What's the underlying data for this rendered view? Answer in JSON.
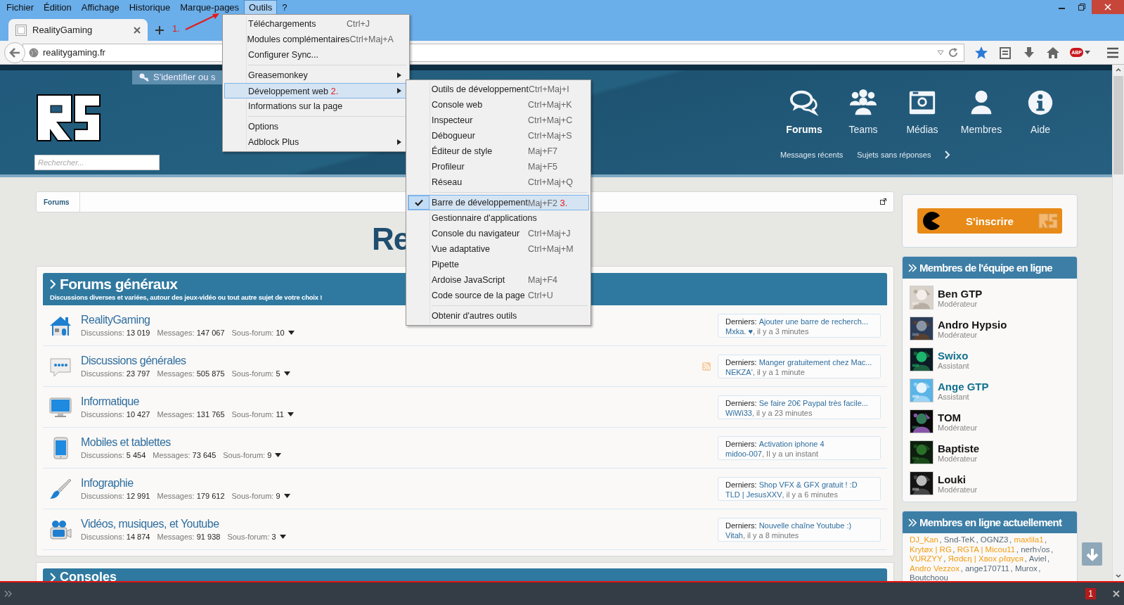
{
  "menu_bar": [
    {
      "label": "Fichier",
      "selected": false
    },
    {
      "label": "Édition",
      "selected": false
    },
    {
      "label": "Affichage",
      "selected": false
    },
    {
      "label": "Historique",
      "selected": false
    },
    {
      "label": "Marque-pages",
      "selected": false
    },
    {
      "label": "Outils",
      "selected": true
    },
    {
      "label": "?",
      "selected": false
    }
  ],
  "tabs": [
    {
      "label": "RealityGaming",
      "selected": true
    }
  ],
  "address_bar": {
    "value": "realitygaming.fr"
  },
  "toolbar": {
    "adblock_label": "ABP"
  },
  "tools_menu": {
    "annotation": "1.",
    "groups": [
      [
        {
          "label": "Téléchargements",
          "shortcut": "Ctrl+J",
          "highlighted": false,
          "submenu": false
        },
        {
          "label": "Modules complémentaires",
          "shortcut": "Ctrl+Maj+A",
          "highlighted": false,
          "submenu": false
        },
        {
          "label": "Configurer Sync...",
          "highlighted": false,
          "submenu": false
        }
      ],
      [
        {
          "label": "Greasemonkey",
          "highlighted": false,
          "submenu": true
        },
        {
          "label": "Développement web",
          "highlighted": true,
          "submenu": true,
          "annotation": "2."
        },
        {
          "label": "Informations sur la page",
          "highlighted": false,
          "submenu": false
        }
      ],
      [
        {
          "label": "Options",
          "highlighted": false,
          "submenu": false
        },
        {
          "label": "Adblock Plus",
          "highlighted": false,
          "submenu": true
        }
      ]
    ]
  },
  "dev_menu": {
    "groups": [
      [
        {
          "label": "Outils de développement",
          "shortcut": "Ctrl+Maj+I",
          "checked": false,
          "highlighted": false
        },
        {
          "label": "Console web",
          "shortcut": "Ctrl+Maj+K",
          "checked": false,
          "highlighted": false
        },
        {
          "label": "Inspecteur",
          "shortcut": "Ctrl+Maj+C",
          "checked": false,
          "highlighted": false
        },
        {
          "label": "Débogueur",
          "shortcut": "Ctrl+Maj+S",
          "checked": false,
          "highlighted": false
        },
        {
          "label": "Éditeur de style",
          "shortcut": "Maj+F7",
          "checked": false,
          "highlighted": false
        },
        {
          "label": "Profileur",
          "shortcut": "Maj+F5",
          "checked": false,
          "highlighted": false
        },
        {
          "label": "Réseau",
          "shortcut": "Ctrl+Maj+Q",
          "checked": false,
          "highlighted": false
        }
      ],
      [
        {
          "label": "Barre de développement",
          "shortcut": "Maj+F2",
          "checked": true,
          "highlighted": true,
          "annotation": "3."
        },
        {
          "label": "Gestionnaire d'applications",
          "checked": false,
          "highlighted": false
        },
        {
          "label": "Console du navigateur",
          "shortcut": "Ctrl+Maj+J",
          "checked": false,
          "highlighted": false
        },
        {
          "label": "Vue adaptative",
          "shortcut": "Ctrl+Maj+M",
          "checked": false,
          "highlighted": false
        },
        {
          "label": "Pipette",
          "checked": false,
          "highlighted": false
        },
        {
          "label": "Ardoise JavaScript",
          "shortcut": "Maj+F4",
          "checked": false,
          "highlighted": false
        },
        {
          "label": "Code source de la page",
          "shortcut": "Ctrl+U",
          "checked": false,
          "highlighted": false
        }
      ],
      [
        {
          "label": "Obtenir d'autres outils",
          "checked": false,
          "highlighted": false
        }
      ]
    ]
  },
  "site_header": {
    "login": "S'identifier ou s",
    "search_placeholder": "Rechercher...",
    "nav": [
      {
        "label": "Forums",
        "kind": "forums",
        "selected": true
      },
      {
        "label": "Teams",
        "kind": "teams",
        "selected": false
      },
      {
        "label": "Médias",
        "kind": "media",
        "selected": false
      },
      {
        "label": "Membres",
        "kind": "members",
        "selected": false
      },
      {
        "label": "Aide",
        "kind": "help",
        "selected": false
      }
    ],
    "subnav": [
      "Messages récents",
      "Sujets sans réponses"
    ]
  },
  "breadcrumb": [
    "Forums"
  ],
  "page_title": "Re",
  "category": {
    "title": "Forums généraux",
    "description": "Discussions diverses et variées, autour des jeux-vidéo ou tout autre sujet de votre choix !",
    "forums": [
      {
        "kind": "home",
        "name": "RealityGaming",
        "stats": [
          {
            "label": "Discussions:",
            "value": "13 019"
          },
          {
            "label": "Messages:",
            "value": "147 067"
          },
          {
            "label": "Sous-forum:",
            "value": "10"
          }
        ],
        "rss": false,
        "last": {
          "label": "Derniers:",
          "title": "Ajouter une barre de recherch...",
          "user": "Mxka. ♥",
          "time": ", il y a 3 minutes"
        }
      },
      {
        "kind": "chat",
        "name": "Discussions générales",
        "stats": [
          {
            "label": "Discussions:",
            "value": "23 797"
          },
          {
            "label": "Messages:",
            "value": "505 875"
          },
          {
            "label": "Sous-forum:",
            "value": "5"
          }
        ],
        "rss": true,
        "last": {
          "label": "Derniers:",
          "title": "Manger gratuitement chez Mac...",
          "user": "NEKZA'",
          "time": ", il y a 1 minute"
        }
      },
      {
        "kind": "monitor",
        "name": "Informatique",
        "stats": [
          {
            "label": "Discussions:",
            "value": "10 427"
          },
          {
            "label": "Messages:",
            "value": "131 765"
          },
          {
            "label": "Sous-forum:",
            "value": "11"
          }
        ],
        "rss": false,
        "last": {
          "label": "Derniers:",
          "title": "Se faire 20€ Paypal très facile...",
          "user": "WiWi33",
          "time": ", il y a 23 minutes"
        }
      },
      {
        "kind": "tablet",
        "name": "Mobiles et tablettes",
        "stats": [
          {
            "label": "Discussions:",
            "value": "5 454"
          },
          {
            "label": "Messages:",
            "value": "73 645"
          },
          {
            "label": "Sous-forum:",
            "value": "9"
          }
        ],
        "rss": false,
        "last": {
          "label": "Derniers:",
          "title": "Activation iphone 4",
          "user": "midoo-007",
          "time": ", Il y a un instant"
        }
      },
      {
        "kind": "brush",
        "name": "Infographie",
        "stats": [
          {
            "label": "Discussions:",
            "value": "12 991"
          },
          {
            "label": "Messages:",
            "value": "179 612"
          },
          {
            "label": "Sous-forum:",
            "value": "9"
          }
        ],
        "rss": false,
        "last": {
          "label": "Derniers:",
          "title": "Shop VFX & GFX gratuit ! :D",
          "user": "TLD | JesusXXV",
          "time": ", il y a 6 minutes"
        }
      },
      {
        "kind": "camera",
        "name": "Vidéos, musiques, et Youtube",
        "stats": [
          {
            "label": "Discussions:",
            "value": "14 874"
          },
          {
            "label": "Messages:",
            "value": "91 938"
          },
          {
            "label": "Sous-forum:",
            "value": "3"
          }
        ],
        "rss": false,
        "last": {
          "label": "Derniers:",
          "title": "Nouvelle chaîne Youtube :)",
          "user": "Vitah",
          "time": ", il y a 8 minutes"
        }
      }
    ]
  },
  "next_category": {
    "title": "Consoles"
  },
  "sidebar": {
    "signup": "S'inscrire",
    "staff": {
      "title": "Membres de l'équipe en ligne",
      "members": [
        {
          "name": "Ben GTP",
          "role": "Modérateur",
          "color": "#141414"
        },
        {
          "name": "Andro Hypsio",
          "role": "Modérateur",
          "color": "#141414"
        },
        {
          "name": "Swixo",
          "role": "Assistant",
          "color": "#11718f"
        },
        {
          "name": "Ange GTP",
          "role": "Assistant",
          "color": "#11718f"
        },
        {
          "name": "TOM",
          "role": "Modérateur",
          "color": "#141414"
        },
        {
          "name": "Baptiste",
          "role": "Modérateur",
          "color": "#141414"
        },
        {
          "name": "Louki",
          "role": "Modérateur",
          "color": "#141414"
        }
      ]
    },
    "online": {
      "title": "Membres en ligne actuellement",
      "names": [
        {
          "name": "DJ_Kan",
          "color": "#f39c12",
          "separator": ","
        },
        {
          "name": "Snd-TeK",
          "color": "#5a6b7b",
          "separator": ","
        },
        {
          "name": "OGNZ3",
          "color": "#5a6b7b",
          "separator": ","
        },
        {
          "name": "maxlila1",
          "color": "#f39c12",
          "separator": ","
        },
        {
          "name": "Krytøx | RG",
          "color": "#f39c12",
          "separator": ","
        },
        {
          "name": "RGTA | Micou11",
          "color": "#f39c12",
          "separator": ","
        },
        {
          "name": "nerh√os",
          "color": "#5a6b7b",
          "separator": ","
        },
        {
          "name": "VURZYY",
          "color": "#f39c12",
          "separator": ","
        },
        {
          "name": "Яσdєη | Χвox ρℓαуєя",
          "color": "#f39c12",
          "separator": ","
        },
        {
          "name": "Aviel",
          "color": "#5a6b7b",
          "separator": ","
        },
        {
          "name": "Andro Vezzox",
          "color": "#f39c12",
          "separator": ","
        },
        {
          "name": "ange170711",
          "color": "#5a6b7b",
          "separator": ","
        },
        {
          "name": "Murox",
          "color": "#5a6b7b",
          "separator": ","
        },
        {
          "name": "Boutchoou",
          "color": "#5a6b7b"
        }
      ]
    }
  },
  "dev_toolbar": {
    "error_count": "1"
  }
}
